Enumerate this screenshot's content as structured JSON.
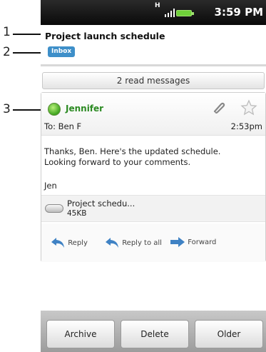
{
  "callouts": [
    "1",
    "2",
    "3"
  ],
  "status_bar": {
    "time": "3:59 PM",
    "network": "H"
  },
  "email": {
    "subject": "Project launch schedule",
    "label": "Inbox",
    "read_messages": "2 read messages",
    "sender": "Jennifer",
    "to": "To: Ben F",
    "time": "2:53pm",
    "body_line1": "Thanks, Ben. Here's the updated schedule.",
    "body_line2": "Looking forward to your comments.",
    "signature": "Jen",
    "attachment": {
      "name": "Project schedu...",
      "size": "45KB"
    }
  },
  "actions": {
    "reply": "Reply",
    "reply_all": "Reply to all",
    "forward": "Forward"
  },
  "bottom_bar": {
    "archive": "Archive",
    "delete": "Delete",
    "older": "Older"
  },
  "colors": {
    "sender": "#2b8a22",
    "label_badge": "#3e8fc9",
    "status_bar": "#0a0a0a"
  },
  "icons": [
    "signal-icon",
    "battery-icon",
    "presence-icon",
    "attachment-clip-icon",
    "star-icon",
    "reply-icon",
    "reply-all-icon",
    "forward-icon"
  ]
}
